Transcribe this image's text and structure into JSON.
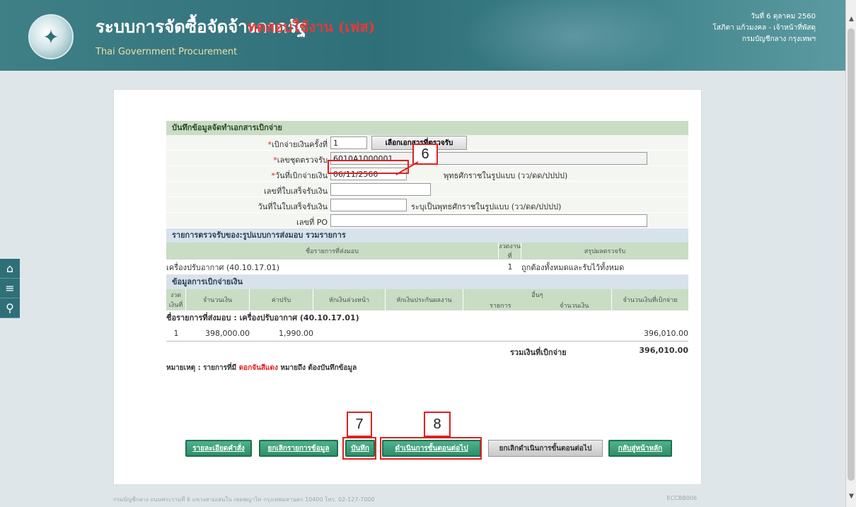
{
  "header": {
    "title_th": "ระบบการจัดซื้อจัดจ้างภาครัฐ",
    "title_sub": "ทดสอบใช้งาน (เฟส)",
    "title_en": "Thai Government Procurement",
    "date_line": "วันที่ 6 ตุลาคม 2560",
    "user_line": "โสภิตา แก้วมงคล - เจ้าหน้าที่พัสดุ",
    "org_line": "กรมบัญชีกลาง กรุงเทพฯ"
  },
  "sidebar": [
    "home-icon",
    "menu-icon",
    "search-icon"
  ],
  "form": {
    "section1": "บันทึกข้อมูลจัดทำเอกสารเบิกจ่าย",
    "installment_label": "เบิกจ่ายเงินครั้งที่",
    "installment_value": "1",
    "select_doc_button": "เลือกเอกสารที่ตรวจรับ",
    "inspect_no_label": "เลขชุดตรวจรับ",
    "inspect_no_value": "6010A1000001",
    "pay_date_label": "วันที่เบิกจ่ายเงิน",
    "pay_date_value": "06/11/2560",
    "pay_date_hint": "พุทธศักราชในรูปแบบ (วว/ดด/ปปปป)",
    "receipt_no_label": "เลขที่ใบเสร็จรับเงิน",
    "receipt_no_value": "",
    "receipt_date_label": "วันที่ในใบเสร็จรับเงิน",
    "receipt_date_value": "",
    "receipt_date_hint": "ระบุเป็นพุทธศักราชในรูปแบบ (วว/ดด/ปปปป)",
    "po_label": "เลขที่ PO",
    "po_value": "",
    "section2": "รายการตรวจรับของ:รูปแบบการส่งมอบ รวมรายการ",
    "items_head": {
      "name": "ชื่อรายการที่ส่งมอบ",
      "period": "งวดงานที่",
      "result": "สรุปผลตรวจรับ"
    },
    "item": {
      "name": "เครื่องปรับอากาศ (40.10.17.01)",
      "period": "1",
      "result": "ถูกต้องทั้งหมดและรับไว้ทั้งหมด"
    },
    "section3": "ข้อมูลการเบิกจ่ายเงิน",
    "pay_head": {
      "period": "งวดเงินที่",
      "amount": "จำนวนเงิน",
      "fine": "ค่าปรับ",
      "advance": "หักเงินล่วงหน้า",
      "retention": "หักเงินประกันผลงาน",
      "other": "อื่นๆ",
      "other_item": "รายการ",
      "other_amount": "จำนวนเงิน",
      "total": "จำนวนเงินที่เบิกจ่าย"
    },
    "pay_group": "ชื่อรายการที่ส่งมอบ : เครื่องปรับอากาศ (40.10.17.01)",
    "pay_row": {
      "period": "1",
      "amount": "398,000.00",
      "fine": "1,990.00",
      "total": "396,010.00"
    },
    "sum_label": "รวมเงินที่เบิกจ่าย",
    "sum_value": "396,010.00",
    "note_prefix": "หมายเหตุ : รายการที่มี",
    "note_red": "ดอกจันสีแดง",
    "note_suffix": "หมายถึง ต้องบันทึกข้อมูล"
  },
  "buttons": {
    "b1": "รายละเอียดคำสั่ง",
    "b2": "ยกเลิกรายการข้อมูล",
    "save": "บันทึก",
    "next": "ดำเนินการขั้นตอนต่อไป",
    "cancel_next": "ยกเลิกดำเนินการขั้นตอนต่อไป",
    "back": "กลับสู่หน้าหลัก"
  },
  "callouts": {
    "c6": "6",
    "c7": "7",
    "c8": "8"
  },
  "footer": "กรมบัญชีกลาง ถนนพระรามที่ 6 แขวงสามเสนใน เขตพญาไท กรุงเทพมหานคร 10400 โทร. 02-127-7000",
  "footer_right": "ECCBB006"
}
